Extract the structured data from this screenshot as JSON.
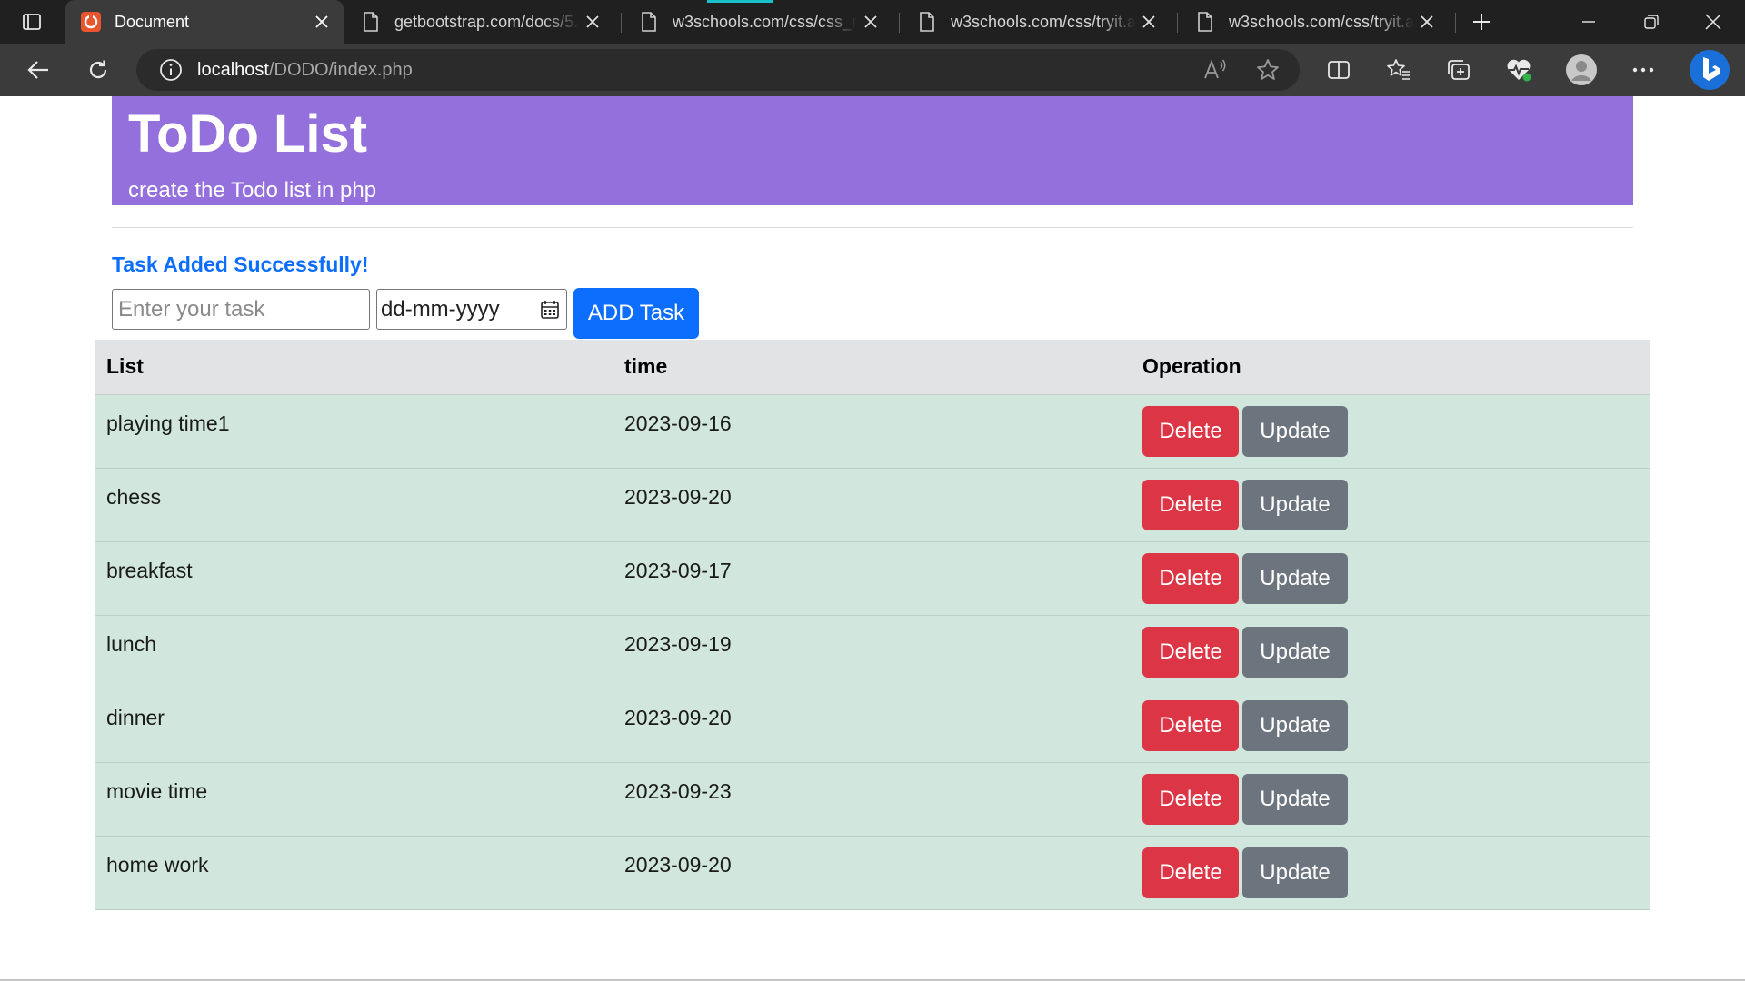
{
  "browser": {
    "tabs": [
      {
        "title": "Document",
        "active": true,
        "icon": "site-favicon"
      },
      {
        "title": "getbootstrap.com/docs/5.",
        "active": false,
        "icon": "page-icon"
      },
      {
        "title": "w3schools.com/css/css_na",
        "active": false,
        "icon": "page-icon"
      },
      {
        "title": "w3schools.com/css/tryit.as",
        "active": false,
        "icon": "page-icon"
      },
      {
        "title": "w3schools.com/css/tryit.as",
        "active": false,
        "icon": "page-icon"
      }
    ],
    "address": {
      "host": "localhost",
      "path": "/DODO/index.php"
    }
  },
  "header": {
    "title": "ToDo List",
    "subtitle": "create the Todo list in php"
  },
  "message": "Task Added Successfully!",
  "form": {
    "task_placeholder": "Enter your task",
    "date_placeholder": "dd-mm-yyyy",
    "add_label": "ADD Task"
  },
  "table": {
    "headers": [
      "List",
      "time",
      "Operation"
    ],
    "delete_label": "Delete",
    "update_label": "Update",
    "rows": [
      {
        "task": "playing time1",
        "time": "2023-09-16"
      },
      {
        "task": "chess",
        "time": "2023-09-20"
      },
      {
        "task": "breakfast",
        "time": "2023-09-17"
      },
      {
        "task": "lunch",
        "time": "2023-09-19"
      },
      {
        "task": "dinner",
        "time": "2023-09-20"
      },
      {
        "task": "movie time",
        "time": "2023-09-23"
      },
      {
        "task": "home work",
        "time": "2023-09-20"
      }
    ]
  },
  "colors": {
    "jumbotron": "#9370db",
    "primary": "#0d6efd",
    "danger": "#dc3545",
    "secondary": "#6c757d",
    "row_success": "#d1e7dd"
  }
}
